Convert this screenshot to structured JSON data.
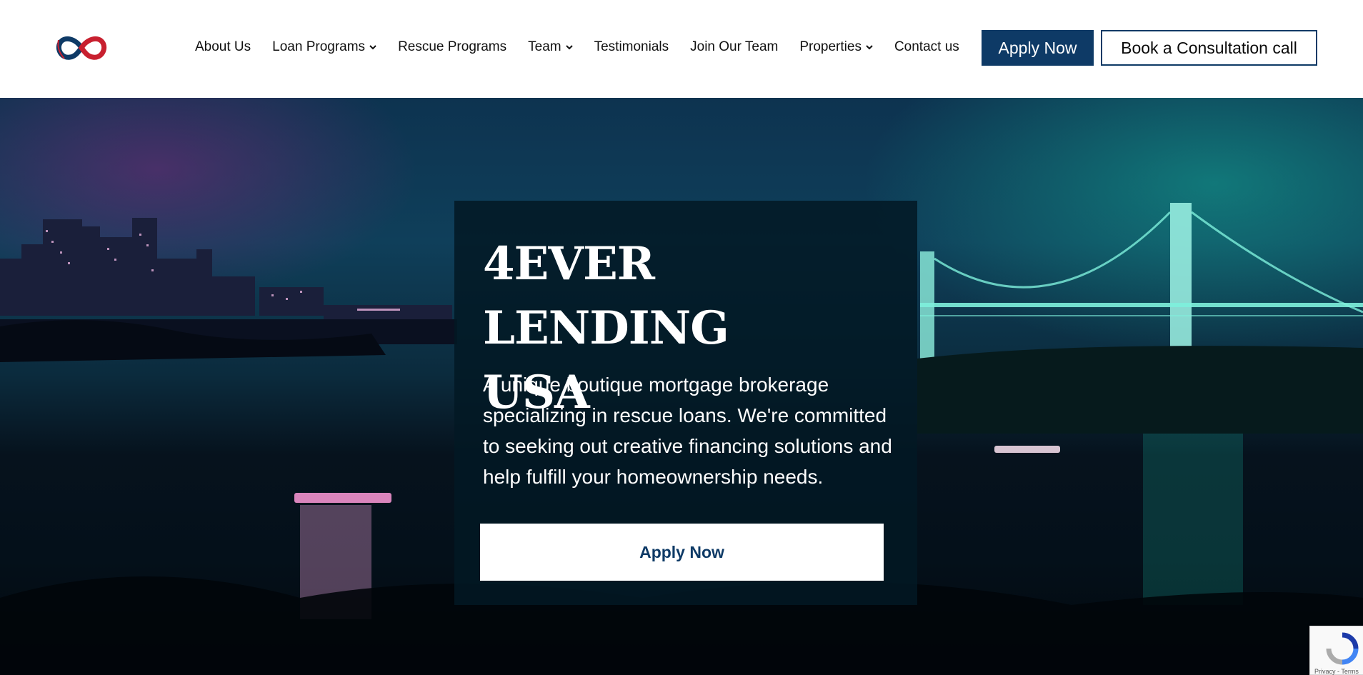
{
  "header": {
    "logo_alt": "4Ever Lending USA",
    "nav": [
      {
        "label": "About Us",
        "has_dropdown": false
      },
      {
        "label": "Loan Programs",
        "has_dropdown": true
      },
      {
        "label": "Rescue Programs",
        "has_dropdown": false
      },
      {
        "label": "Team",
        "has_dropdown": true
      },
      {
        "label": "Testimonials",
        "has_dropdown": false
      },
      {
        "label": "Join Our Team",
        "has_dropdown": false
      },
      {
        "label": "Properties",
        "has_dropdown": true
      },
      {
        "label": "Contact us",
        "has_dropdown": false
      }
    ],
    "apply_label": "Apply Now",
    "consult_label": "Book a Consultation call"
  },
  "hero": {
    "title_line1": "4EVER LENDING",
    "title_line2": "USA",
    "description": "A unique boutique mortgage brokerage specializing in rescue loans. We're committed to seeking out creative financing solutions and help fulfill your homeownership needs.",
    "button_label": "Apply Now"
  },
  "recaptcha": {
    "text": "Privacy - Terms"
  },
  "colors": {
    "brand_navy": "#0e3a66",
    "logo_red": "#c8202f",
    "card_bg": "#021824"
  }
}
